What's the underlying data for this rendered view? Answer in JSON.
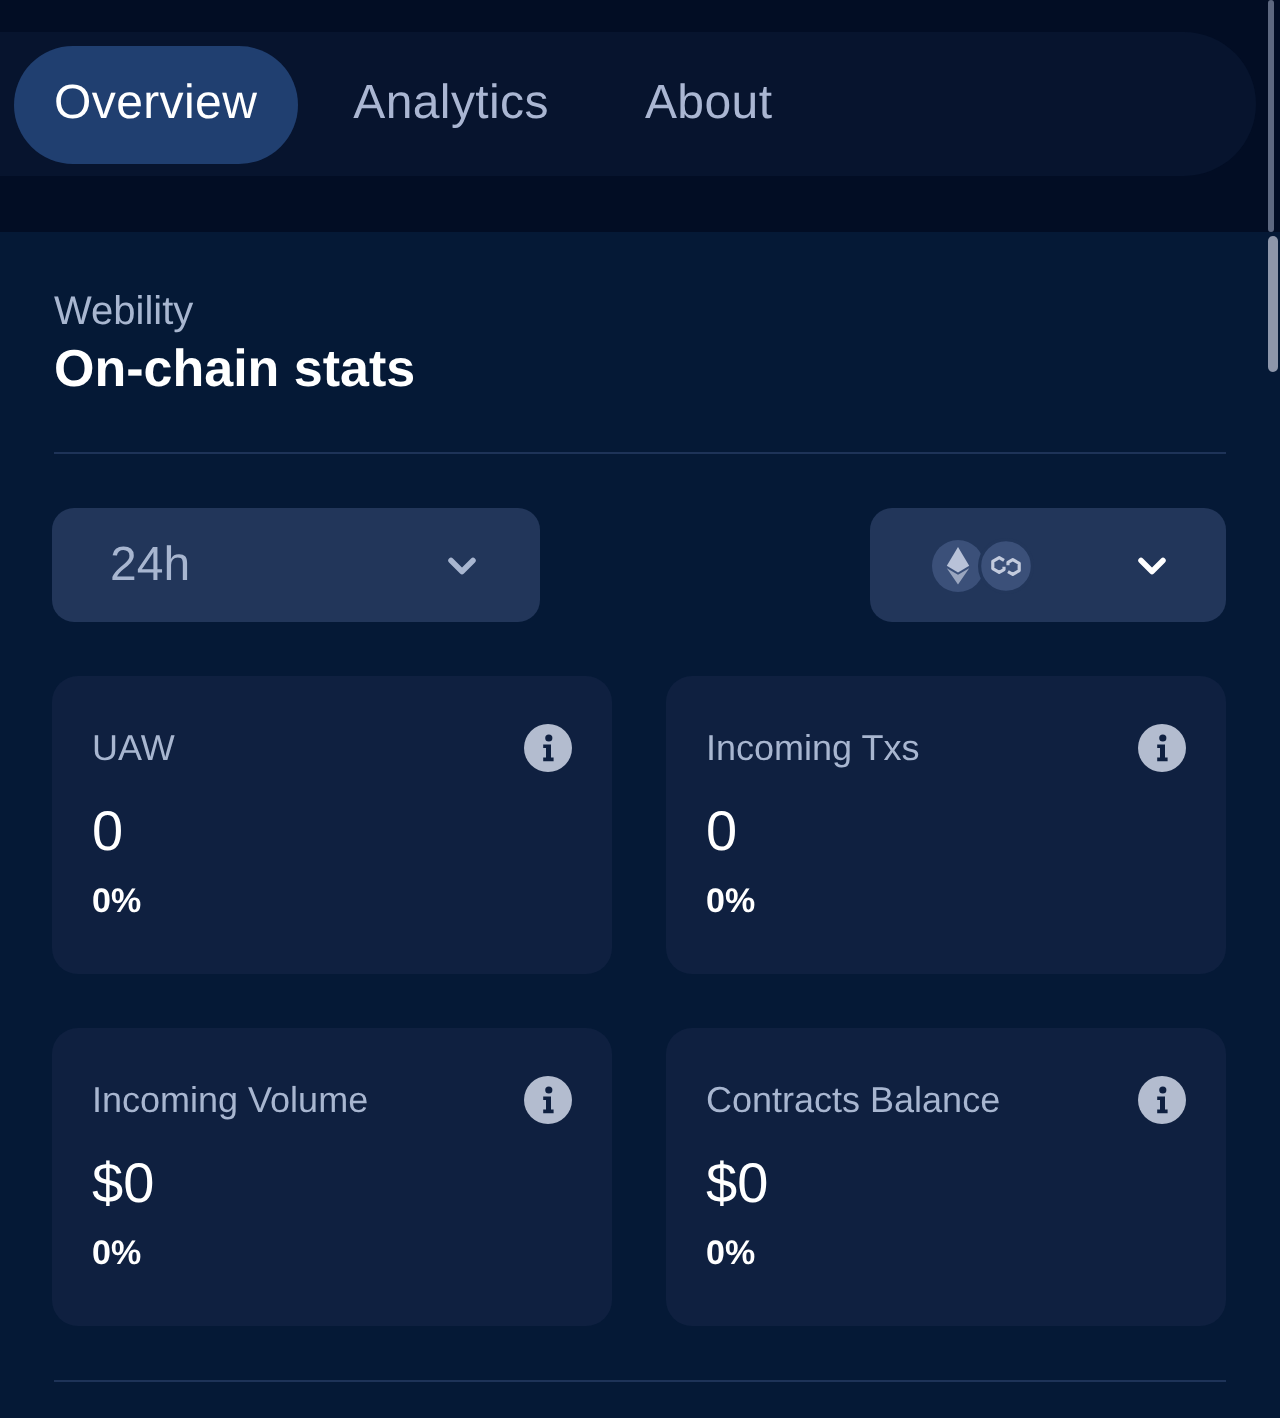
{
  "tabs": [
    {
      "label": "Overview",
      "selected": true
    },
    {
      "label": "Analytics",
      "selected": false
    },
    {
      "label": "About",
      "selected": false
    }
  ],
  "header": {
    "subtitle": "Webility",
    "title": "On-chain stats"
  },
  "filters": {
    "period": {
      "value": "24h"
    }
  },
  "stats": [
    {
      "label": "UAW",
      "value": "0",
      "change": "0%"
    },
    {
      "label": "Incoming Txs",
      "value": "0",
      "change": "0%"
    },
    {
      "label": "Incoming Volume",
      "value": "$0",
      "change": "0%"
    },
    {
      "label": "Contracts Balance",
      "value": "$0",
      "change": "0%"
    }
  ]
}
